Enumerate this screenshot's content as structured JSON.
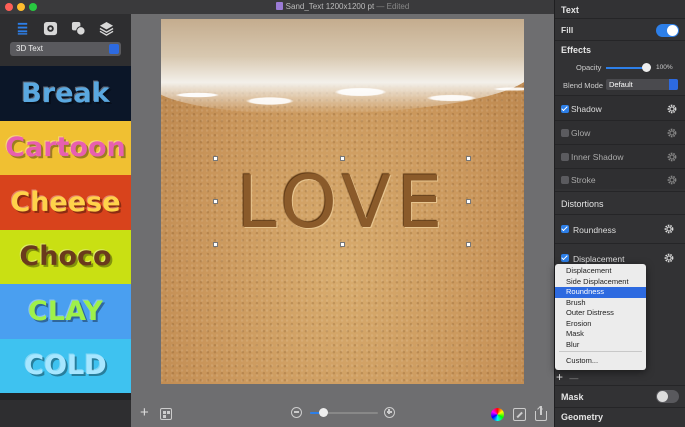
{
  "window": {
    "document_title": "Sand_Text 1200x1200 pt",
    "edited_label": "— Edited"
  },
  "left_panel": {
    "preset_category": "3D Text",
    "presets": [
      {
        "label": "Break",
        "bg": "#0b1628",
        "fg": "#5aa8e0"
      },
      {
        "label": "Cartoon",
        "bg": "#f0c032",
        "fg": "#e85fb0"
      },
      {
        "label": "Cheese",
        "bg": "#d8431c",
        "fg": "#ffd24a"
      },
      {
        "label": "Choco",
        "bg": "#c9e013",
        "fg": "#6a3a1c"
      },
      {
        "label": "CLAY",
        "bg": "#4a9ff0",
        "fg": "#9ef04a"
      },
      {
        "label": "COLD",
        "bg": "#3ec2f0",
        "fg": "#a7e6ff"
      },
      {
        "label": "",
        "bg": "#222326",
        "fg": "#888"
      }
    ],
    "toolbar_icons": [
      "list-icon",
      "gear-icon",
      "shapes-icon",
      "layers-icon"
    ],
    "bottom_icons": [
      "plus-icon",
      "grid-icon"
    ]
  },
  "canvas": {
    "text": "LOVE"
  },
  "inspector": {
    "text_header": "Text",
    "fill_label": "Fill",
    "fill_on": true,
    "effects_header": "Effects",
    "opacity_label": "Opacity",
    "opacity_value": "100%",
    "blend_label": "Blend Mode",
    "blend_value": "Default",
    "effects": [
      {
        "label": "Shadow",
        "checked": true
      },
      {
        "label": "Glow",
        "checked": false
      },
      {
        "label": "Inner Shadow",
        "checked": false
      },
      {
        "label": "Stroke",
        "checked": false
      }
    ],
    "distortions_header": "Distortions",
    "distortions": [
      {
        "label": "Roundness",
        "checked": true
      },
      {
        "label": "Displacement",
        "checked": true
      }
    ],
    "mask_label": "Mask",
    "mask_on": false,
    "geometry_header": "Geometry",
    "add_label": "+",
    "remove_label": "—"
  },
  "popup_menu": {
    "items": [
      "Displacement",
      "Side Displacement",
      "Roundness",
      "Brush",
      "Outer Distress",
      "Erosion",
      "Mask",
      "Blur"
    ],
    "selected": "Roundness",
    "custom_label": "Custom..."
  }
}
